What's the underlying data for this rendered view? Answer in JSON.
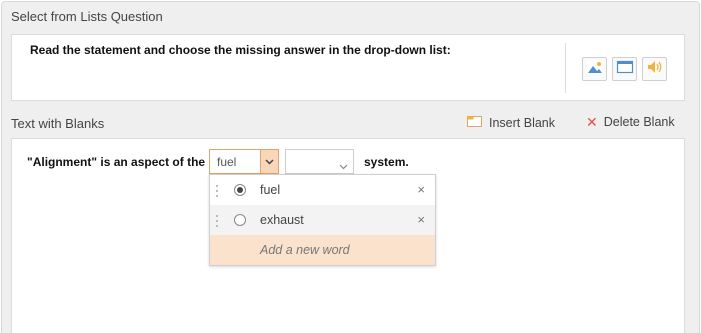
{
  "header": {
    "title": "Select from Lists Question"
  },
  "question": {
    "text": "Read the statement and choose the missing answer in the drop-down list:"
  },
  "media_buttons": [
    {
      "icon": "image-icon"
    },
    {
      "icon": "window-icon"
    },
    {
      "icon": "speaker-icon"
    }
  ],
  "blanks_section": {
    "title": "Text with Blanks",
    "insert_label": "Insert Blank",
    "delete_label": "Delete Blank"
  },
  "sentence": {
    "before": "\"Alignment\" is an aspect of the",
    "after": "system."
  },
  "blank1": {
    "value": "fuel"
  },
  "dropdown": {
    "options": [
      {
        "label": "fuel",
        "selected": true,
        "delete": "×"
      },
      {
        "label": "exhaust",
        "selected": false,
        "delete": "×"
      }
    ],
    "add_placeholder": "Add a new word"
  },
  "colors": {
    "accent": "#e0a46c",
    "accent_light": "#fbe2cc",
    "delete_red": "#e0524c"
  }
}
